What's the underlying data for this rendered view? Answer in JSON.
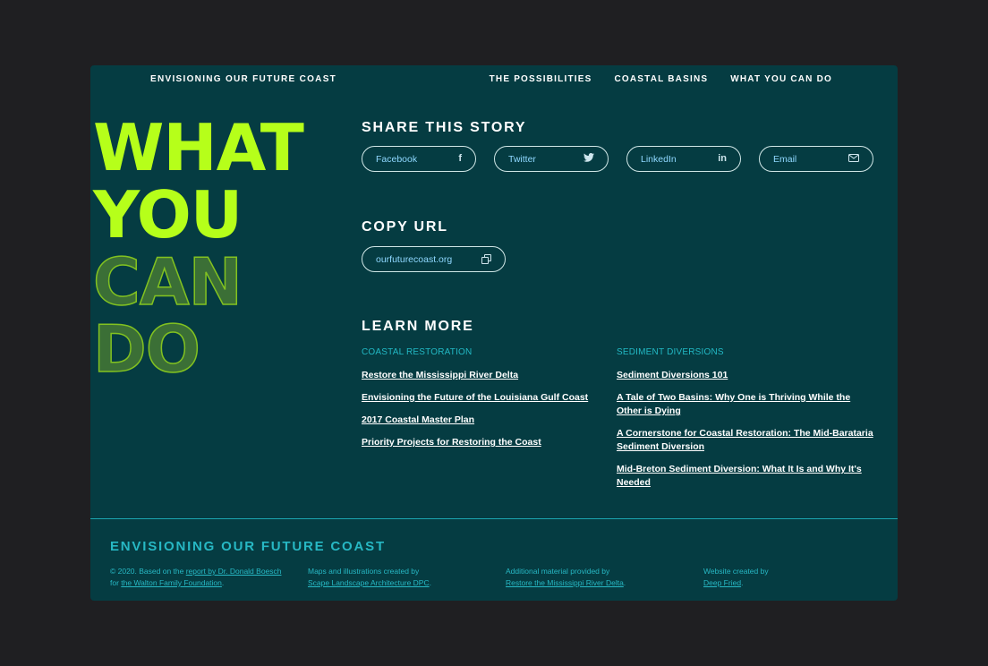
{
  "nav": {
    "brand": "ENVISIONING OUR FUTURE COAST",
    "links": [
      "THE POSSIBILITIES",
      "COASTAL BASINS",
      "WHAT YOU CAN DO"
    ]
  },
  "hero": {
    "lines": [
      "WHAT",
      "YOU",
      "CAN",
      "DO"
    ]
  },
  "share": {
    "title": "SHARE THIS STORY",
    "buttons": [
      {
        "label": "Facebook",
        "icon": "facebook-icon"
      },
      {
        "label": "Twitter",
        "icon": "twitter-icon"
      },
      {
        "label": "LinkedIn",
        "icon": "linkedin-icon"
      },
      {
        "label": "Email",
        "icon": "email-icon"
      }
    ]
  },
  "copy_url": {
    "title": "COPY URL",
    "value": "ourfuturecoast.org",
    "icon": "copy-icon"
  },
  "learn_more": {
    "title": "LEARN MORE",
    "columns": [
      {
        "category": "COASTAL RESTORATION",
        "links": [
          "Restore the Mississippi River Delta",
          "Envisioning the Future of the Louisiana Gulf Coast",
          "2017 Coastal Master Plan",
          "Priority Projects for Restoring the Coast"
        ]
      },
      {
        "category": "SEDIMENT DIVERSIONS",
        "links": [
          "Sediment Diversions 101",
          "A Tale of Two Basins: Why One is Thriving While the Other is Dying",
          "A Cornerstone for Coastal Restoration: The Mid-Barataria Sediment Diversion",
          "Mid-Breton Sediment Diversion: What It Is and Why It's Needed"
        ]
      }
    ]
  },
  "footer": {
    "title": "ENVISIONING OUR FUTURE COAST",
    "credits": [
      {
        "l1_text": "© 2020. Based on the ",
        "l1_link": "report by Dr. Donald Boesch",
        "l2_text": "for ",
        "l2_link": "the Walton Family Foundation",
        "end": "."
      },
      {
        "l1_text": "Maps and illustrations created by",
        "l1_link": "",
        "l2_text": "",
        "l2_link": "Scape Landscape Architecture DPC",
        "end": "."
      },
      {
        "l1_text": "Additional material provided by",
        "l1_link": "",
        "l2_text": "",
        "l2_link": "Restore the Mississippi River Delta",
        "end": "."
      },
      {
        "l1_text": "Website created by",
        "l1_link": "",
        "l2_text": "",
        "l2_link": "Deep Fried",
        "end": "."
      }
    ]
  },
  "colors": {
    "panel": "#053c42",
    "accent_green": "#b6ff1a",
    "accent_teal": "#27b8c4",
    "page_bg": "#1f1f22"
  }
}
